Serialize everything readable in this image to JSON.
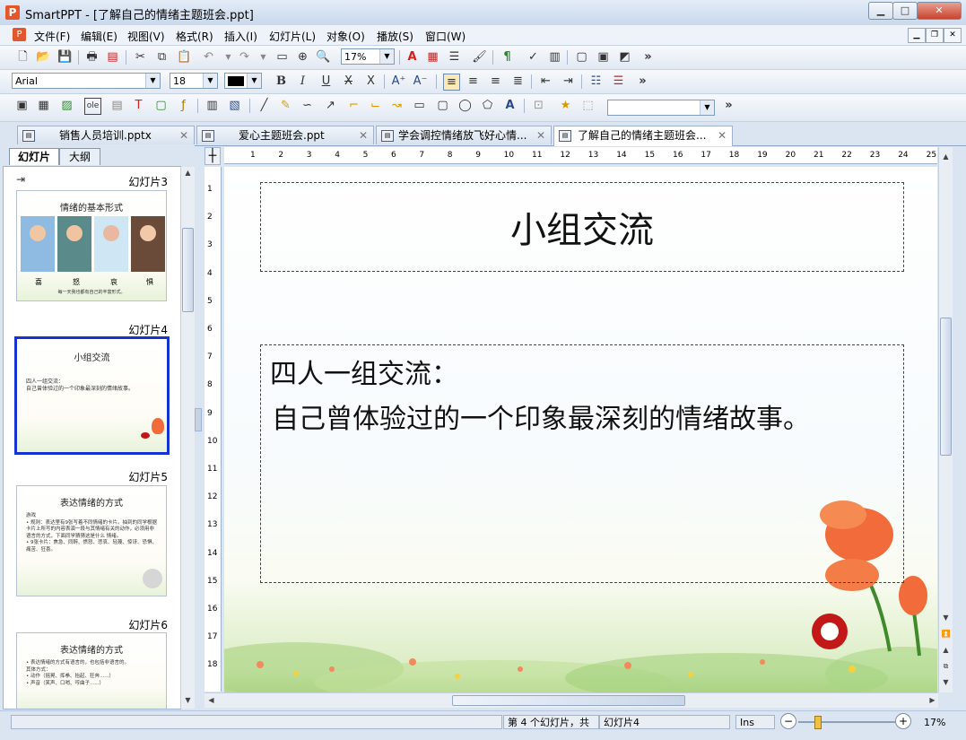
{
  "window": {
    "title": "SmartPPT - [了解自己的情绪主题班会.ppt]",
    "app_icon": "P",
    "minimize": "▁",
    "maximize": "□",
    "close": "✕"
  },
  "menu": [
    "文件(F)",
    "编辑(E)",
    "视图(V)",
    "格式(R)",
    "插入(I)",
    "幻灯片(L)",
    "对象(O)",
    "播放(S)",
    "窗口(W)"
  ],
  "toolbar": {
    "zoom_value": "17%",
    "font_name": "Arial",
    "font_size": "18",
    "more": "»"
  },
  "tabs": [
    {
      "label": "销售人员培训.pptx",
      "active": false
    },
    {
      "label": "爱心主题班会.ppt",
      "active": false
    },
    {
      "label": "学会调控情绪放飞好心情...",
      "active": false
    },
    {
      "label": "了解自己的情绪主题班会...",
      "active": true
    }
  ],
  "panel_tabs": {
    "slides": "幻灯片",
    "outline": "大纲"
  },
  "thumbnails": [
    {
      "label": "幻灯片3",
      "title": "情绪的基本形式",
      "captions": [
        "喜",
        "怒",
        "哀",
        "惧"
      ],
      "footer": "每一天我也都有自己的丰富形式。"
    },
    {
      "label": "幻灯片4",
      "title": "小组交流",
      "text": "四人一组交流：\n自己曾体验过的一个印象最深刻的情绪故事。",
      "selected": true
    },
    {
      "label": "幻灯片5",
      "title": "表达情绪的方式",
      "text": "游戏\n• 规则：表达里有9张写着不同情绪的卡片。抽到的同学根据卡片上所写的内容表演一段与其情绪有关的动作，必须用非语言的方式，下面同学猜猜这是什么 情绪。\n• 9张卡片：焦急、同醉、愤怒、悲哀、轻蔑、惊讶、恐惧、痛苦、狂喜。"
    },
    {
      "label": "幻灯片6",
      "title": "表达情绪的方式",
      "text": "• 表达情绪的方式有语言的，也包括非语言的。\n其体方式：\n• 动作（摇晃、挥拳、抬起、狂奔......）\n• 声音（笑声、口哨、哼曲子......）"
    }
  ],
  "slide": {
    "title": "小组交流",
    "line1": "四人一组交流：",
    "line2": "自己曾体验过的一个印象最深刻的情绪故事。"
  },
  "hruler_ticks": [
    "1",
    "2",
    "3",
    "4",
    "5",
    "6",
    "7",
    "8",
    "9",
    "10",
    "11",
    "12",
    "13",
    "14",
    "15",
    "16",
    "17",
    "18",
    "19",
    "20",
    "21",
    "22",
    "23",
    "24",
    "25"
  ],
  "vruler_ticks": [
    "1",
    "2",
    "3",
    "4",
    "5",
    "6",
    "7",
    "8",
    "9",
    "10",
    "11",
    "12",
    "13",
    "14",
    "15",
    "16",
    "17",
    "18"
  ],
  "status": {
    "slide_info": "第 4 个幻灯片，共",
    "slide_name": "幻灯片4",
    "mode": "Ins",
    "zoom": "17%"
  },
  "colors": {
    "accent": "#1533d0",
    "flower": "#f26b3a"
  }
}
